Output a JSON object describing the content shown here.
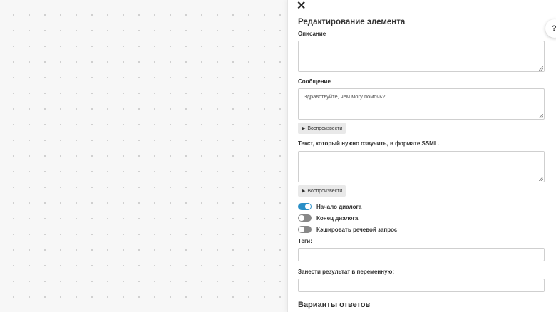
{
  "panel": {
    "title": "Редактирование элемента",
    "help_label": "?",
    "close_label": "✕"
  },
  "description": {
    "label": "Описание",
    "value": ""
  },
  "message": {
    "label": "Сообщение",
    "value": "Здравствуйте, чем могу помочь?",
    "play_label": "Воспроизвести"
  },
  "ssml": {
    "label": "Текст, который нужно озвучить, в формате SSML.",
    "value": "",
    "play_label": "Воспроизвести"
  },
  "toggles": [
    {
      "label": "Начало диалога",
      "on": true
    },
    {
      "label": "Конец диалога",
      "on": false
    },
    {
      "label": "Кэшировать речевой запрос",
      "on": false
    }
  ],
  "tags": {
    "label": "Теги:",
    "value": ""
  },
  "result_variable": {
    "label": "Занести результат в переменную:",
    "value": ""
  },
  "answers": {
    "title": "Варианты ответов"
  },
  "colors": {
    "accent": "#2a8fc7",
    "toggle_off": "#888888"
  }
}
